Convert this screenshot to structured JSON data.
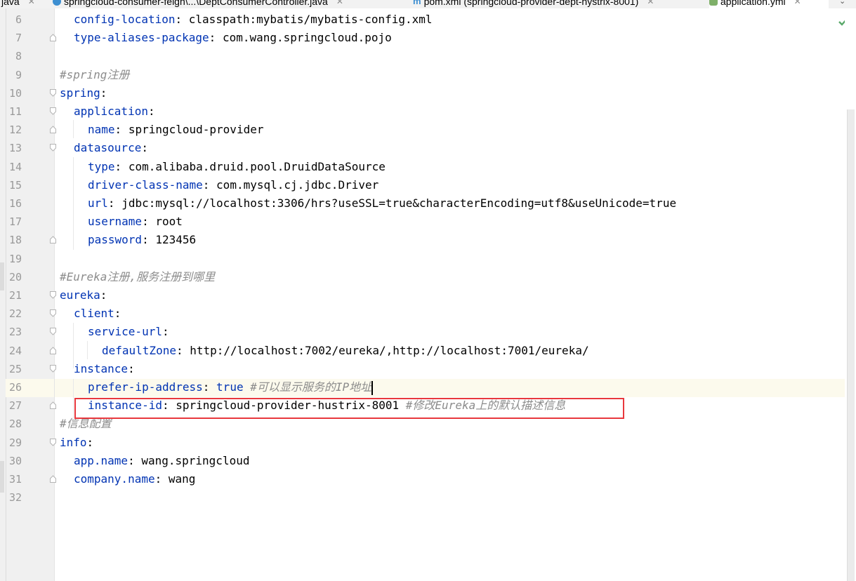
{
  "tabs": [
    {
      "label": "java",
      "icon": "java-file-icon"
    },
    {
      "label": "springcloud-consumer-feign\\...\\DeptConsumerController.java",
      "icon": "java-class-icon"
    },
    {
      "label": "pom.xml (springcloud-provider-dept-hystrix-8001)",
      "icon": "maven-icon"
    },
    {
      "label": "application.yml",
      "icon": "yaml-file-icon",
      "active": true
    }
  ],
  "status": {
    "inspection": "check-icon",
    "inspection_color": "#59a869"
  },
  "colors": {
    "key": "#0033b3",
    "comment": "#8c8c8c",
    "highlight_border": "#e8383d",
    "current_line": "#fcfaed"
  },
  "lines": [
    {
      "n": "6",
      "key": "config-location",
      "value": "classpath:mybatis/mybatis-config.xml",
      "indent": 1
    },
    {
      "n": "7",
      "key": "type-aliases-package",
      "value": "com.wang.springcloud.pojo",
      "indent": 1
    },
    {
      "n": "8"
    },
    {
      "n": "9",
      "comment": "#spring注册"
    },
    {
      "n": "10",
      "key": "spring",
      "indent": 0
    },
    {
      "n": "11",
      "key": "application",
      "indent": 1
    },
    {
      "n": "12",
      "key": "name",
      "value": "springcloud-provider",
      "indent": 2
    },
    {
      "n": "13",
      "key": "datasource",
      "indent": 1
    },
    {
      "n": "14",
      "key": "type",
      "value": "com.alibaba.druid.pool.DruidDataSource",
      "indent": 2
    },
    {
      "n": "15",
      "key": "driver-class-name",
      "value": "com.mysql.cj.jdbc.Driver",
      "indent": 2
    },
    {
      "n": "16",
      "key": "url",
      "value": "jdbc:mysql://localhost:3306/hrs?useSSL=true&characterEncoding=utf8&useUnicode=true",
      "indent": 2
    },
    {
      "n": "17",
      "key": "username",
      "value": "root",
      "indent": 2
    },
    {
      "n": "18",
      "key": "password",
      "value": "123456",
      "indent": 2
    },
    {
      "n": "19"
    },
    {
      "n": "20",
      "comment": "#Eureka注册,服务注册到哪里"
    },
    {
      "n": "21",
      "key": "eureka",
      "indent": 0
    },
    {
      "n": "22",
      "key": "client",
      "indent": 1
    },
    {
      "n": "23",
      "key": "service-url",
      "indent": 2
    },
    {
      "n": "24",
      "key": "defaultZone",
      "value": "http://localhost:7002/eureka/,http://localhost:7001/eureka/",
      "indent": 3
    },
    {
      "n": "25",
      "key": "instance",
      "indent": 1
    },
    {
      "n": "26",
      "key": "prefer-ip-address",
      "bool": "true",
      "comment": "#可以显示服务的IP地址",
      "indent": 2,
      "current": true
    },
    {
      "n": "27",
      "key": "instance-id",
      "value": "springcloud-provider-hustrix-8001",
      "comment": "#修改Eureka上的默认描述信息",
      "indent": 2
    },
    {
      "n": "28",
      "comment": "#信息配置"
    },
    {
      "n": "29",
      "key": "info",
      "indent": 0
    },
    {
      "n": "30",
      "key": "app.name",
      "value": "wang.springcloud",
      "indent": 1
    },
    {
      "n": "31",
      "key": "company.name",
      "value": "wang",
      "indent": 1
    },
    {
      "n": "32"
    }
  ]
}
